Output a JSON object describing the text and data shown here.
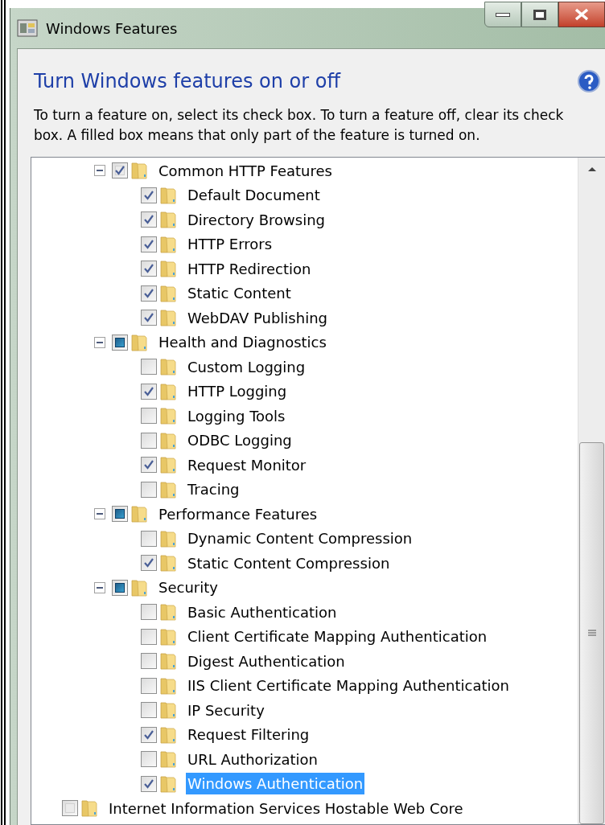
{
  "window": {
    "title": "Windows Features"
  },
  "heading": "Turn Windows features on or off",
  "description": "To turn a feature on, select its check box. To turn a feature off, clear its check box. A filled box means that only part of the feature is turned on.",
  "tree": {
    "items": [
      {
        "kind": "group",
        "label": "Common HTTP Features",
        "checked": true,
        "partial": false,
        "expanded": true,
        "selected": false,
        "children": [
          {
            "label": "Default Document",
            "checked": true,
            "selected": false
          },
          {
            "label": "Directory Browsing",
            "checked": true,
            "selected": false
          },
          {
            "label": "HTTP Errors",
            "checked": true,
            "selected": false
          },
          {
            "label": "HTTP Redirection",
            "checked": true,
            "selected": false
          },
          {
            "label": "Static Content",
            "checked": true,
            "selected": false
          },
          {
            "label": "WebDAV Publishing",
            "checked": true,
            "selected": false
          }
        ]
      },
      {
        "kind": "group",
        "label": "Health and Diagnostics",
        "checked": false,
        "partial": true,
        "expanded": true,
        "selected": false,
        "children": [
          {
            "label": "Custom Logging",
            "checked": false,
            "selected": false
          },
          {
            "label": "HTTP Logging",
            "checked": true,
            "selected": false
          },
          {
            "label": "Logging Tools",
            "checked": false,
            "selected": false
          },
          {
            "label": "ODBC Logging",
            "checked": false,
            "selected": false
          },
          {
            "label": "Request Monitor",
            "checked": true,
            "selected": false
          },
          {
            "label": "Tracing",
            "checked": false,
            "selected": false
          }
        ]
      },
      {
        "kind": "group",
        "label": "Performance Features",
        "checked": false,
        "partial": true,
        "expanded": true,
        "selected": false,
        "children": [
          {
            "label": "Dynamic Content Compression",
            "checked": false,
            "selected": false
          },
          {
            "label": "Static Content Compression",
            "checked": true,
            "selected": false
          }
        ]
      },
      {
        "kind": "group",
        "label": "Security",
        "checked": false,
        "partial": true,
        "expanded": true,
        "selected": false,
        "children": [
          {
            "label": "Basic Authentication",
            "checked": false,
            "selected": false
          },
          {
            "label": "Client Certificate Mapping Authentication",
            "checked": false,
            "selected": false
          },
          {
            "label": "Digest Authentication",
            "checked": false,
            "selected": false
          },
          {
            "label": "IIS Client Certificate Mapping Authentication",
            "checked": false,
            "selected": false
          },
          {
            "label": "IP Security",
            "checked": false,
            "selected": false
          },
          {
            "label": "Request Filtering",
            "checked": true,
            "selected": false
          },
          {
            "label": "URL Authorization",
            "checked": false,
            "selected": false
          },
          {
            "label": "Windows Authentication",
            "checked": true,
            "selected": true
          }
        ]
      },
      {
        "kind": "top_level",
        "label": "Internet Information Services Hostable Web Core",
        "checked": false,
        "partial": false,
        "selected": false
      }
    ]
  }
}
